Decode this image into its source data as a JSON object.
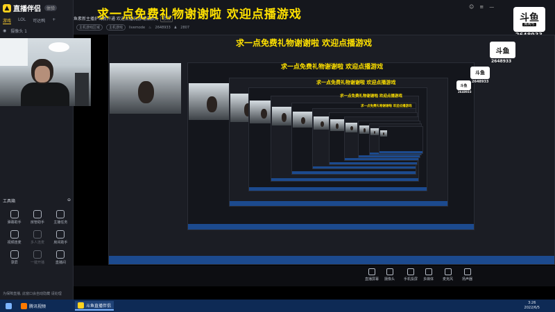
{
  "app": {
    "logo_name": "直播伴侣",
    "version_tag": "体验",
    "tabs": [
      "游戏",
      "LOL",
      "可达鸭"
    ],
    "scene_label": "摄像头 1"
  },
  "header": {
    "stream_title": "鱼素新主播护驾新开通 欢迎点播玩游戏成聊天",
    "title_tag": "修改",
    "category_1": "主机游戏区域",
    "category_2": "主机游戏",
    "status_text": "livemode",
    "hot_count": "2648933",
    "follower_count": "2807",
    "banner_text": "求一点免费礼物谢谢啦 欢迎点播游戏"
  },
  "douyu": {
    "logo_text": "斗鱼",
    "logo_sub": "房间号",
    "room_number": "2648933"
  },
  "toolbox": {
    "title": "工具箱",
    "items": [
      {
        "label": "弹幕助手",
        "icon": "danmaku-helper-icon",
        "dim": false
      },
      {
        "label": "房管助手",
        "icon": "room-manager-icon",
        "dim": false
      },
      {
        "label": "主播任务",
        "icon": "streamer-task-icon",
        "dim": false
      },
      {
        "label": "视频连麦",
        "icon": "video-link-icon",
        "dim": false
      },
      {
        "label": "多人连麦",
        "icon": "multi-link-icon",
        "dim": true
      },
      {
        "label": "房间助手",
        "icon": "room-helper-icon",
        "dim": false
      },
      {
        "label": "录屏",
        "icon": "record-icon",
        "dim": false
      },
      {
        "label": "一键开播",
        "icon": "one-click-stream-icon",
        "dim": true
      },
      {
        "label": "直播间",
        "icon": "live-room-icon",
        "dim": false
      }
    ]
  },
  "footer_status": "为保障直播, 此窗口会自动隐藏 请处理",
  "controls": [
    {
      "label": "直播屏幕",
      "icon": "screen-capture-icon"
    },
    {
      "label": "摄像头",
      "icon": "camera-icon"
    },
    {
      "label": "手机投屏",
      "icon": "phone-cast-icon"
    },
    {
      "label": "多媒体",
      "icon": "multimedia-icon"
    },
    {
      "label": "麦克风",
      "icon": "microphone-icon"
    },
    {
      "label": "扬声器",
      "icon": "speaker-icon"
    }
  ],
  "taskbar": {
    "items": [
      {
        "label": "腾讯视频",
        "color": "#ff7a00"
      },
      {
        "label": "斗鱼直播伴侣",
        "color": "#ffd21e"
      }
    ],
    "time": "3:26",
    "date": "2022/6/5"
  },
  "recursive": {
    "banner": "求一点免费礼物谢谢啦 欢迎点播游戏",
    "room_number": "2648933"
  },
  "colors": {
    "banner": "#ffe100",
    "accent": "#ffcf2e",
    "panel": "#1b1d24",
    "taskbar": "#0e2a55"
  }
}
